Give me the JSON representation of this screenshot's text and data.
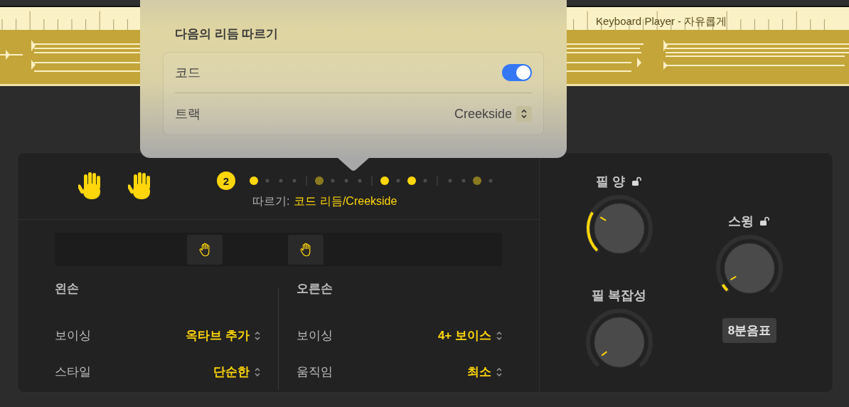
{
  "track": {
    "title": "Keyboard Player - 자유롭게"
  },
  "popover": {
    "title": "다음의 리듬 따르기",
    "rows": [
      {
        "kind": "toggle",
        "label": "코드",
        "on": true
      },
      {
        "kind": "popup",
        "label": "트랙",
        "value": "Creekside"
      }
    ]
  },
  "rhythm": {
    "badge": "2",
    "follow_label": "따르기:",
    "follow_value": "코드 리듬/Creekside",
    "beats": [
      [
        {
          "on": true,
          "dimmed": false
        },
        {
          "on": false,
          "dimmed": false
        },
        {
          "on": false,
          "dimmed": false
        },
        {
          "on": false,
          "dimmed": false
        }
      ],
      [
        {
          "on": true,
          "dimmed": true
        },
        {
          "on": false,
          "dimmed": false
        },
        {
          "on": false,
          "dimmed": false
        },
        {
          "on": false,
          "dimmed": false
        }
      ],
      [
        {
          "on": true,
          "dimmed": false
        },
        {
          "on": false,
          "dimmed": false
        },
        {
          "on": true,
          "dimmed": false
        },
        {
          "on": false,
          "dimmed": false
        }
      ],
      [
        {
          "on": false,
          "dimmed": false
        },
        {
          "on": false,
          "dimmed": false
        },
        {
          "on": true,
          "dimmed": true
        },
        {
          "on": false,
          "dimmed": false
        }
      ]
    ]
  },
  "hands": [
    {
      "title": "왼손",
      "rows": [
        {
          "label": "보이싱",
          "value": "옥타브 추가"
        },
        {
          "label": "스타일",
          "value": "단순한"
        }
      ]
    },
    {
      "title": "오른손",
      "rows": [
        {
          "label": "보이싱",
          "value": "4+ 보이스"
        },
        {
          "label": "움직임",
          "value": "최소"
        }
      ]
    }
  ],
  "knobs": [
    {
      "label": "필 양",
      "locked": false
    },
    {
      "label": "필 복잡성"
    },
    {
      "label": "스윙",
      "locked": false
    }
  ],
  "swing_value": "8분음표"
}
